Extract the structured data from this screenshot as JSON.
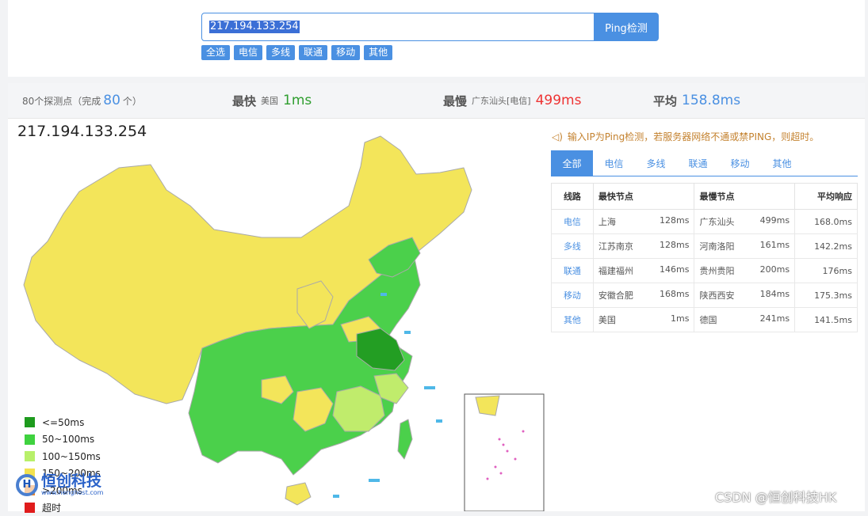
{
  "search": {
    "value": "217.194.133.254",
    "button": "Ping检测"
  },
  "filters": [
    "全选",
    "电信",
    "多线",
    "联通",
    "移动",
    "其他"
  ],
  "stats": {
    "probes_prefix": "80个探测点（完成",
    "probes_count": "80",
    "probes_suffix": "个）",
    "fastest_label": "最快",
    "fastest_loc": "美国",
    "fastest_value": "1ms",
    "slowest_label": "最慢",
    "slowest_loc": "广东汕头[电信]",
    "slowest_value": "499ms",
    "avg_label": "平均",
    "avg_value": "158.8ms"
  },
  "map": {
    "ip": "217.194.133.254",
    "legend": [
      {
        "label": "<=50ms",
        "color": "#1e9b1e"
      },
      {
        "label": "50~100ms",
        "color": "#3fd23f"
      },
      {
        "label": "100~150ms",
        "color": "#b8f06a"
      },
      {
        "label": "150~200ms",
        "color": "#f3e24f"
      },
      {
        "label": ">200ms",
        "color": "#e9852e"
      },
      {
        "label": "超时",
        "color": "#e01c1c"
      }
    ],
    "colors": {
      "yellow": "#f3e55a",
      "green": "#4bd04b",
      "lightgreen": "#c0ec6c",
      "darkgreen": "#239e23",
      "border": "#a9a9a9"
    }
  },
  "logo": {
    "mark": "H",
    "cn": "恒创科技",
    "en": "www.henghost.com"
  },
  "notice": "输入IP为Ping检测，若服务器网络不通或禁PING，则超时。",
  "tabs": [
    "全部",
    "电信",
    "多线",
    "联通",
    "移动",
    "其他"
  ],
  "table": {
    "headers": [
      "线路",
      "最快节点",
      "最慢节点",
      "平均响应"
    ],
    "rows": [
      {
        "line": "电信",
        "fast_node": "上海",
        "fast_ms": "128ms",
        "slow_node": "广东汕头",
        "slow_ms": "499ms",
        "avg": "168.0ms"
      },
      {
        "line": "多线",
        "fast_node": "江苏南京",
        "fast_ms": "128ms",
        "slow_node": "河南洛阳",
        "slow_ms": "161ms",
        "avg": "142.2ms"
      },
      {
        "line": "联通",
        "fast_node": "福建福州",
        "fast_ms": "146ms",
        "slow_node": "贵州贵阳",
        "slow_ms": "200ms",
        "avg": "176ms"
      },
      {
        "line": "移动",
        "fast_node": "安徽合肥",
        "fast_ms": "168ms",
        "slow_node": "陕西西安",
        "slow_ms": "184ms",
        "avg": "175.3ms"
      },
      {
        "line": "其他",
        "fast_node": "美国",
        "fast_ms": "1ms",
        "slow_node": "德国",
        "slow_ms": "241ms",
        "avg": "141.5ms"
      }
    ]
  },
  "watermark": "CSDN @恒创科技HK"
}
